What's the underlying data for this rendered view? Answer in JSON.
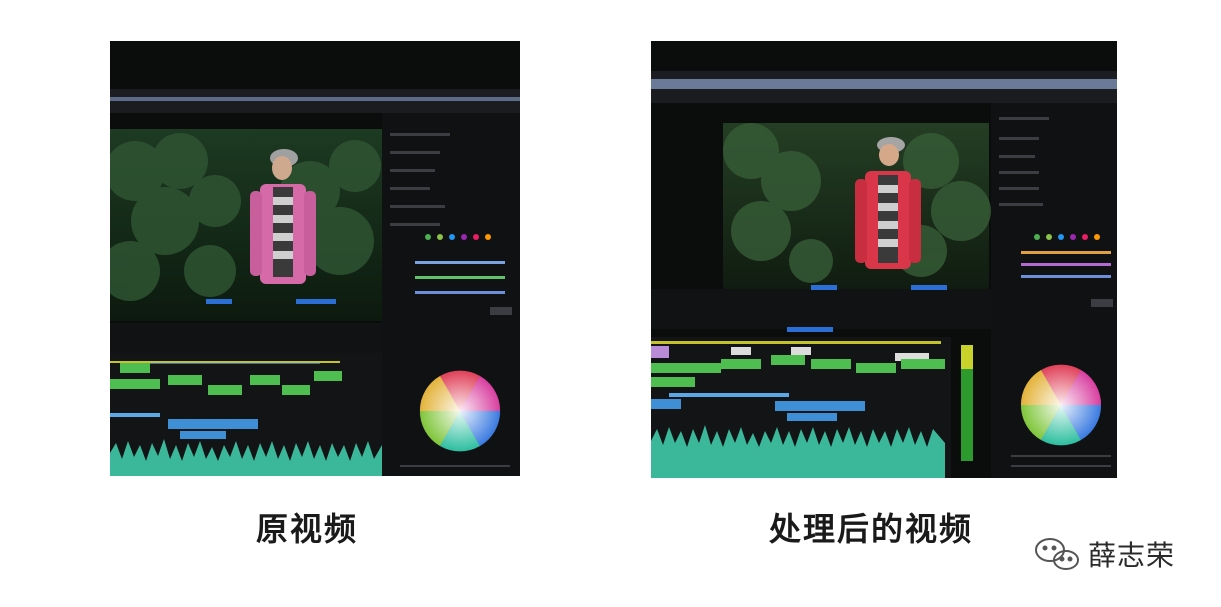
{
  "captions": {
    "original": "原视频",
    "processed": "处理后的视频"
  },
  "watermark": {
    "name": "薛志荣",
    "icon": "wechat-icon"
  },
  "colors": {
    "original_jacket": "#d66aa8",
    "processed_jacket": "#d9364a",
    "wheel_bg": "#0d0d0d"
  }
}
